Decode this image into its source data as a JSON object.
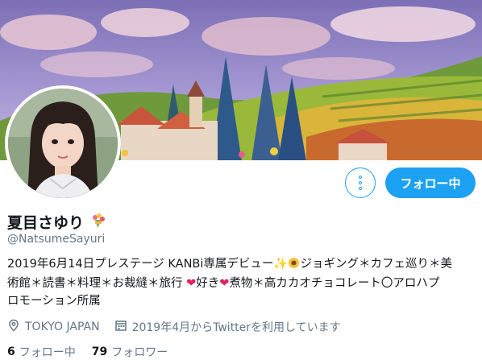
{
  "profile": {
    "name": "夏目さゆり",
    "handle": "@NatsumeSayuri",
    "bio": {
      "line1": "2019年6月14日プレステージ KANBi専属デビュー",
      "line1b": "ジョギング＊カフェ巡り＊美",
      "line2": "術館＊読書＊料理＊お裁縫＊旅行 ",
      "line2b": "好き",
      "line2c": "煮物＊高カカオチョコレート〇アロハプ",
      "line3": "ロモーション所属"
    },
    "location": "TOKYO JAPAN",
    "joined": "2019年4月からTwitterを利用しています"
  },
  "actions": {
    "follow_label": "フォロー中"
  },
  "stats": {
    "following_count": "6",
    "following_label": "フォロー中",
    "followers_count": "79",
    "followers_label": "フォロワー"
  },
  "colors": {
    "accent": "#1da1f2",
    "heart": "#e0245e",
    "muted": "#657786"
  },
  "icons": [
    "bouquet-icon",
    "sparkles-icon",
    "sunflower-icon",
    "heart-icon",
    "more-icon",
    "location-pin-icon",
    "calendar-icon"
  ]
}
